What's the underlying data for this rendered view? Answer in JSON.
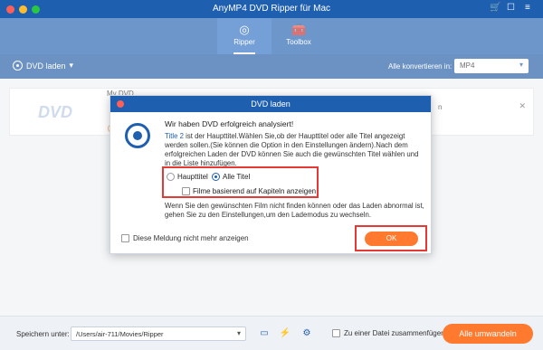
{
  "window": {
    "title": "AnyMP4 DVD Ripper für Mac"
  },
  "nav": {
    "tabs": [
      {
        "label": "Ripper",
        "icon": "disc-icon"
      },
      {
        "label": "Toolbox",
        "icon": "toolbox-icon"
      }
    ]
  },
  "toolbar": {
    "load_dvd": "DVD laden",
    "convert_all_label": "Alle konvertieren in:",
    "format": "MP4"
  },
  "card": {
    "title": "My DVD",
    "thumb_text": "DVD",
    "right_fragment": "n"
  },
  "dialog": {
    "title": "DVD laden",
    "heading": "Wir haben DVD erfolgreich analysiert!",
    "info_highlight": "Title 2",
    "info_text": " ist der Haupttitel.Wählen Sie,ob der Haupttitel oder alle Titel angezeigt werden sollen.(Sie können die Option in den Einstellungen ändern).Nach dem erfolgreichen Laden der DVD können Sie auch die gewünschten Titel wählen und in die Liste hinzufügen.",
    "radio_main": "Haupttitel",
    "radio_all": "Alle Titel",
    "checkbox_chapters": "Filme basierend auf Kapiteln anzeigen",
    "warning": "Wenn Sie den gewünschten Film nicht finden können oder das Laden abnormal ist, gehen Sie zu den Einstellungen,um den Lademodus zu wechseln.",
    "dont_show": "Diese Meldung nicht mehr anzeigen",
    "ok": "OK"
  },
  "bottom": {
    "save_label": "Speichern unter:",
    "path": "/Users/air-711/Movies/Ripper",
    "merge": "Zu einer Datei zusammenfügen",
    "convert_all": "Alle umwandeln"
  },
  "colors": {
    "brand": "#1f5fb0",
    "accent": "#ff7a2e",
    "highlight_frame": "#e53935"
  }
}
